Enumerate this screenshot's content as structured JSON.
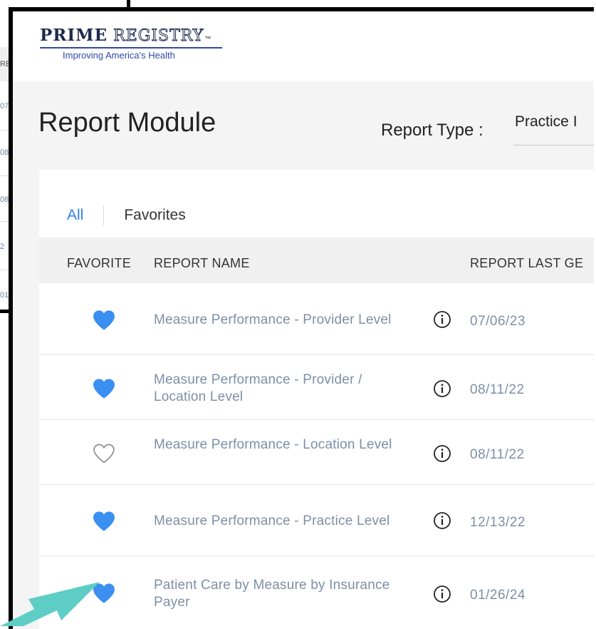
{
  "background_screenshot": {
    "header_fragment": "RE",
    "date_fragments": [
      "07",
      "08",
      "08",
      "2",
      "01"
    ]
  },
  "logo": {
    "prime": "PRIME",
    "registry": "REGISTRY",
    "tm": "™",
    "tagline": "Improving America's Health"
  },
  "page": {
    "title": "Report Module",
    "report_type_label": "Report Type :",
    "report_type_value": "Practice I"
  },
  "tabs": {
    "all": "All",
    "favorites": "Favorites"
  },
  "table": {
    "columns": {
      "favorite": "FAVORITE",
      "report_name": "REPORT NAME",
      "report_last": "REPORT LAST GE"
    },
    "rows": [
      {
        "favorite": true,
        "name": "Measure Performance - Provider Level",
        "date": "07/06/23"
      },
      {
        "favorite": true,
        "name": "Measure Performance - Provider / Location Level",
        "date": "08/11/22"
      },
      {
        "favorite": false,
        "name": "Measure Performance - Location Level",
        "date": "08/11/22"
      },
      {
        "favorite": true,
        "name": "Measure Performance - Practice Level",
        "date": "12/13/22"
      },
      {
        "favorite": true,
        "name": "Patient Care by Measure by Insurance Payer",
        "date": "01/26/24"
      }
    ]
  },
  "colors": {
    "accent": "#2f80ed",
    "heart": "#3b8ff0",
    "arrow": "#5ecdc6",
    "text_muted": "#7e8fa7"
  },
  "icons": {
    "favorite_on": "heart-filled-icon",
    "favorite_off": "heart-outline-icon",
    "info": "info-circle-icon",
    "annotation": "arrow-annotation"
  }
}
